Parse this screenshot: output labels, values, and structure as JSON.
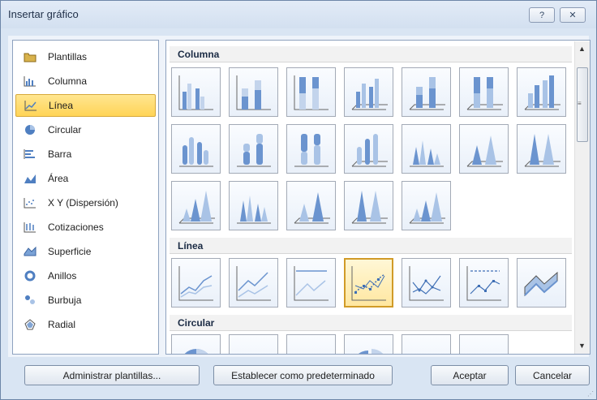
{
  "window": {
    "title": "Insertar gráfico",
    "help_label": "?",
    "close_label": "✕"
  },
  "categories": [
    {
      "label": "Plantillas",
      "icon": "folder-icon"
    },
    {
      "label": "Columna",
      "icon": "column-chart-icon"
    },
    {
      "label": "Línea",
      "icon": "line-chart-icon",
      "selected": true
    },
    {
      "label": "Circular",
      "icon": "pie-chart-icon"
    },
    {
      "label": "Barra",
      "icon": "bar-chart-icon"
    },
    {
      "label": "Área",
      "icon": "area-chart-icon"
    },
    {
      "label": "X Y (Dispersión)",
      "icon": "scatter-chart-icon"
    },
    {
      "label": "Cotizaciones",
      "icon": "stock-chart-icon"
    },
    {
      "label": "Superficie",
      "icon": "surface-chart-icon"
    },
    {
      "label": "Anillos",
      "icon": "doughnut-chart-icon"
    },
    {
      "label": "Burbuja",
      "icon": "bubble-chart-icon"
    },
    {
      "label": "Radial",
      "icon": "radar-chart-icon"
    }
  ],
  "gallery": {
    "sections": [
      {
        "label": "Columna"
      },
      {
        "label": "Línea"
      },
      {
        "label": "Circular"
      }
    ],
    "selected_line_subtype": "line-with-markers"
  },
  "buttons": {
    "manage": "Administrar plantillas...",
    "set_default": "Establecer como predeterminado",
    "ok": "Aceptar",
    "cancel": "Cancelar"
  },
  "colors": {
    "accent": "#ffd457",
    "chart_blue": "#4f7fc1",
    "border": "#8ea2bf"
  }
}
